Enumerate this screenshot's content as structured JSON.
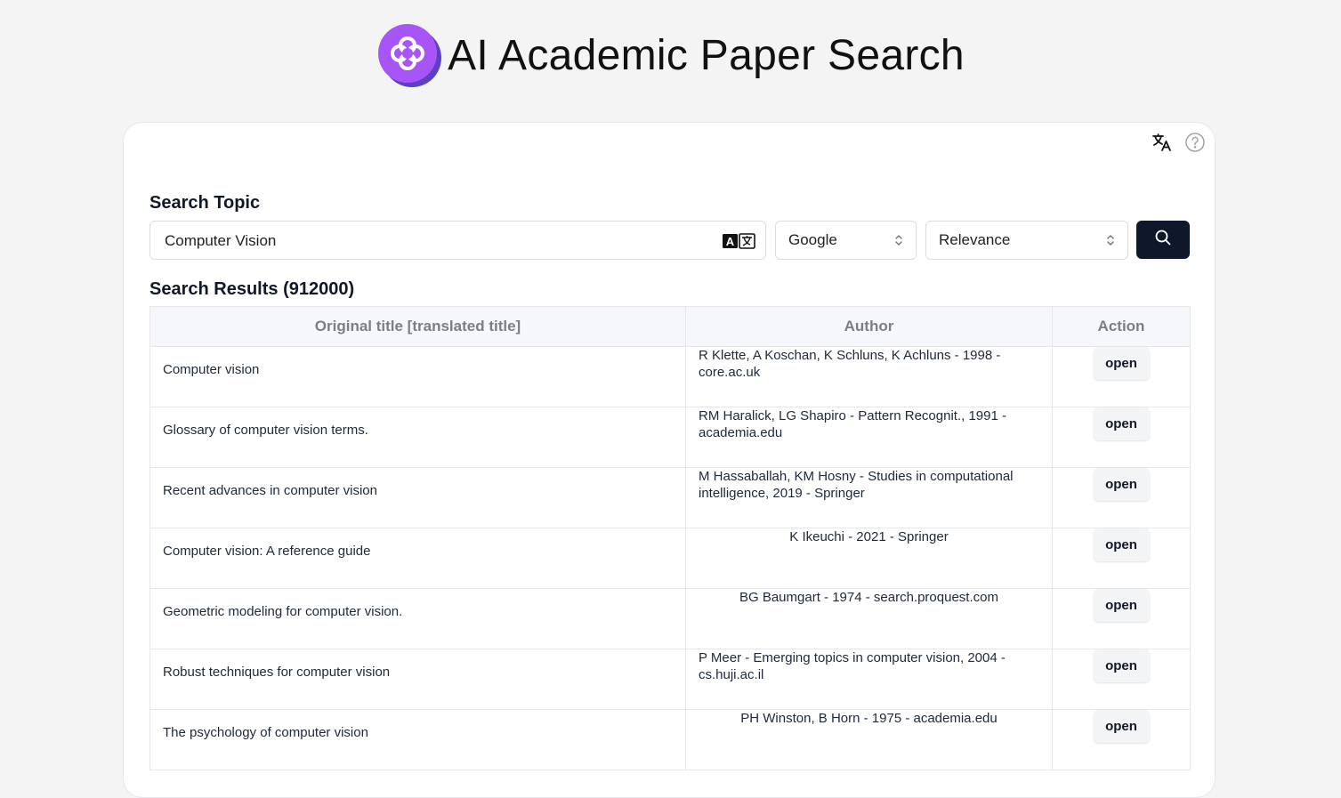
{
  "app": {
    "title": "AI Academic Paper Search",
    "accent_color": "#a855f7",
    "logo_icon": "clover-logo-icon"
  },
  "toolbar": {
    "translate_icon": "translate-icon",
    "help_icon": "help-circle-icon"
  },
  "search": {
    "label": "Search Topic",
    "query": "Computer Vision",
    "engine": "Google",
    "sort": "Relevance",
    "button_icon": "search-icon"
  },
  "results": {
    "heading": "Search Results (912000)",
    "columns": {
      "title": "Original title [translated title]",
      "author": "Author",
      "action": "Action"
    },
    "open_label": "open",
    "rows": [
      {
        "title": "Computer vision",
        "author": "R Klette, A Koschan, K Schluns, K Achluns - 1998 - core.ac.uk"
      },
      {
        "title": "Glossary of computer vision terms.",
        "author": "RM Haralick, LG Shapiro - Pattern Recognit., 1991 - academia.edu"
      },
      {
        "title": "Recent advances in computer vision",
        "author": "M Hassaballah, KM Hosny - Studies in computational intelligence, 2019 - Springer"
      },
      {
        "title": "Computer vision: A reference guide",
        "author": "K Ikeuchi - 2021 - Springer"
      },
      {
        "title": "Geometric modeling for computer vision.",
        "author": "BG Baumgart - 1974 - search.proquest.com"
      },
      {
        "title": "Robust techniques for computer vision",
        "author": "P Meer - Emerging topics in computer vision, 2004 - cs.huji.ac.il"
      },
      {
        "title": "The psychology of computer vision",
        "author": "PH Winston, B Horn - 1975 - academia.edu"
      }
    ]
  }
}
